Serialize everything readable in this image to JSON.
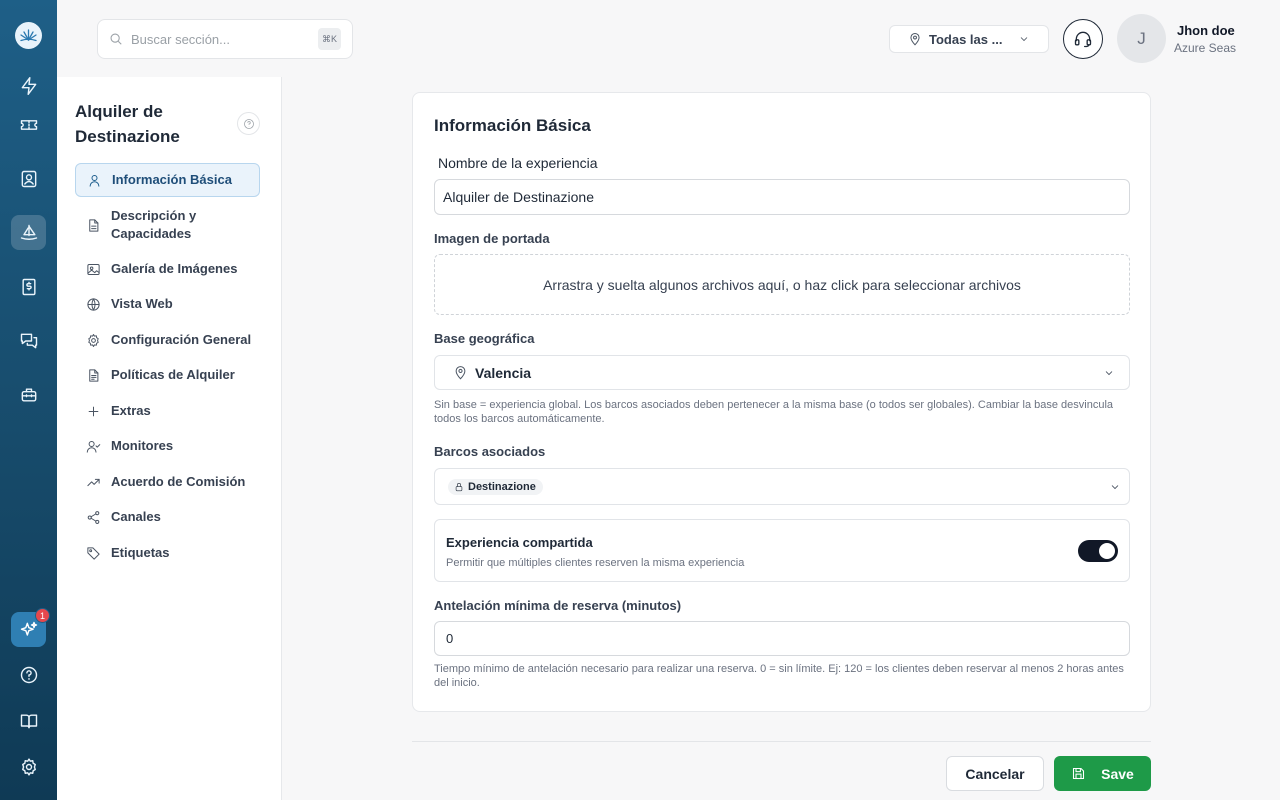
{
  "search": {
    "placeholder": "Buscar sección...",
    "shortcut": "⌘K"
  },
  "header": {
    "location_select": "Todas las ...",
    "user": {
      "initial": "J",
      "name": "Jhon doe",
      "org": "Azure Seas"
    }
  },
  "rail": {
    "icons": [
      "logo-icon",
      "bolt-icon",
      "ticket-icon",
      "contacts-icon",
      "sailboat-icon",
      "invoice-icon",
      "chat-icon",
      "toolbox-icon",
      "ai-sparkle-icon",
      "help-icon",
      "book-icon",
      "settings-icon"
    ],
    "active": "sailboat-icon",
    "notification_count": "1"
  },
  "subnav": {
    "title": "Alquiler de Destinazione",
    "items": [
      {
        "label": "Información Básica",
        "icon": "user-icon",
        "active": true
      },
      {
        "label": "Descripción y Capacidades",
        "icon": "document-icon"
      },
      {
        "label": "Galería de Imágenes",
        "icon": "image-icon"
      },
      {
        "label": "Vista Web",
        "icon": "globe-icon"
      },
      {
        "label": "Configuración General",
        "icon": "gear-icon"
      },
      {
        "label": "Políticas de Alquiler",
        "icon": "policy-icon"
      },
      {
        "label": "Extras",
        "icon": "plus-icon"
      },
      {
        "label": "Monitores",
        "icon": "user-check-icon"
      },
      {
        "label": "Acuerdo de Comisión",
        "icon": "trend-icon"
      },
      {
        "label": "Canales",
        "icon": "share-icon"
      },
      {
        "label": "Etiquetas",
        "icon": "tag-icon"
      }
    ]
  },
  "form": {
    "title": "Información Básica",
    "name_label": "Nombre de la experiencia",
    "name_value": "Alquiler de Destinazione",
    "cover_label": "Imagen de portada",
    "dropzone_text": "Arrastra y suelta algunos archivos aquí, o haz click para seleccionar archivos",
    "base_label": "Base geográfica",
    "base_value": "Valencia",
    "base_helper": "Sin base = experiencia global. Los barcos asociados deben pertenecer a la misma base (o todos ser globales). Cambiar la base desvincula todos los barcos automáticamente.",
    "boats_label": "Barcos asociados",
    "boats_chip": "Destinazione",
    "shared_title": "Experiencia compartida",
    "shared_desc": "Permitir que múltiples clientes reserven la misma experiencia",
    "shared_on": true,
    "lead_label": "Antelación mínima de reserva (minutos)",
    "lead_value": "0",
    "lead_helper": "Tiempo mínimo de antelación necesario para realizar una reserva. 0 = sin límite. Ej: 120 = los clientes deben reservar al menos 2 horas antes del inicio."
  },
  "footer": {
    "cancel_label": "Cancelar",
    "save_label": "Save"
  },
  "colors": {
    "rail": "#1e5f87",
    "accent": "#1f5f8e",
    "save": "#1e9a48",
    "toggle": "#111827",
    "badge": "#e5484d"
  }
}
